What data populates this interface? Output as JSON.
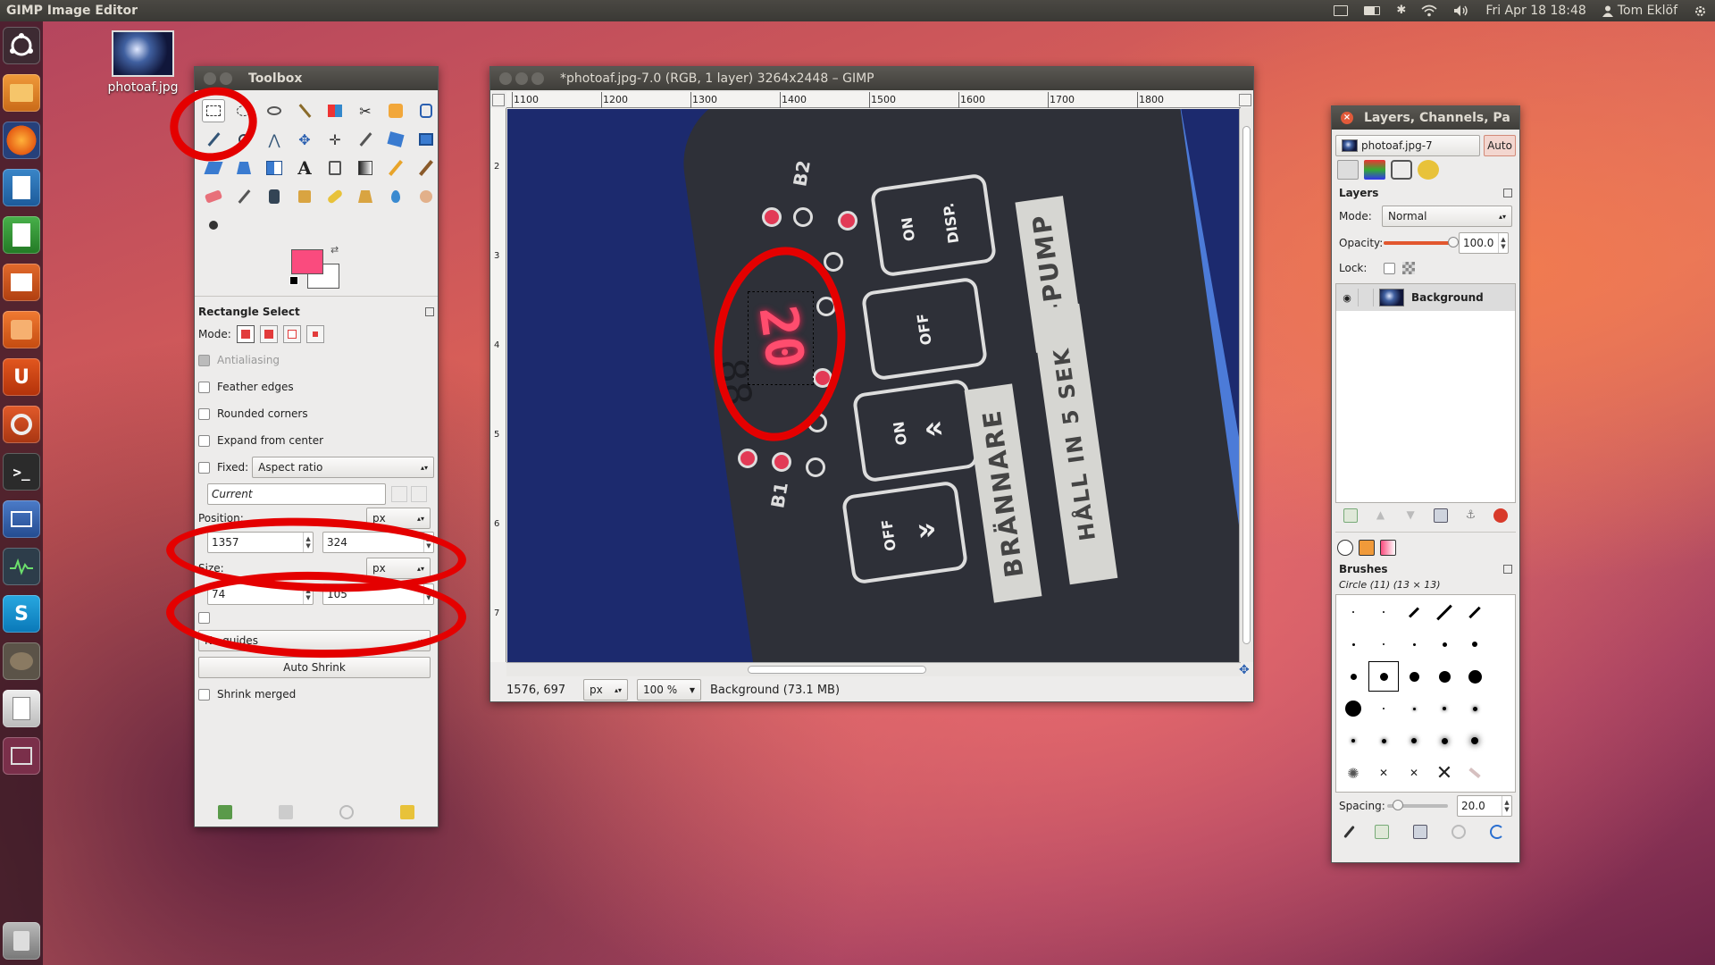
{
  "top_panel": {
    "app_title": "GIMP Image Editor",
    "datetime": "Fri Apr 18 18:48",
    "user": "Tom Eklöf"
  },
  "desktop": {
    "file_icon_label": "photoaf.jpg"
  },
  "toolbox": {
    "title": "Toolbox",
    "fg_color": "#fa4b7e",
    "bg_color": "#ffffff",
    "options": {
      "title": "Rectangle Select",
      "mode_label": "Mode:",
      "antialiasing": "Antialiasing",
      "feather_edges": "Feather edges",
      "rounded_corners": "Rounded corners",
      "expand_from_center": "Expand from center",
      "fixed_label": "Fixed:",
      "fixed_value": "Aspect ratio",
      "current": "Current",
      "position_label": "Position:",
      "position_unit": "px",
      "position_x": "1357",
      "position_y": "324",
      "size_label": "Size:",
      "size_unit": "px",
      "size_w": "74",
      "size_h": "105",
      "guides": "No guides",
      "auto_shrink": "Auto Shrink",
      "shrink_merged": "Shrink merged"
    }
  },
  "image_window": {
    "title": "*photoaf.jpg-7.0 (RGB, 1 layer) 3264x2448 – GIMP",
    "ruler_top": [
      "1100",
      "1200",
      "1300",
      "1400",
      "1500",
      "1600",
      "1700",
      "1800"
    ],
    "ruler_left": [
      "2",
      "3",
      "4",
      "5",
      "6",
      "7"
    ],
    "coords": "1576, 697",
    "unit": "px",
    "zoom": "100 %",
    "status": "Background (73.1 MB)",
    "photo": {
      "digit": "20",
      "label_on_1": "ON",
      "label_off_1": "OFF",
      "label_on_2": "ON",
      "label_off_2": "OFF",
      "label_disp": "DISP.",
      "sticker_cpump": "C-PUMP",
      "sticker_brannare": "BRÄNNARE",
      "sticker_hall": "HÅLL IN 5 SEK",
      "label_b1": "B1",
      "label_b2": "B2"
    }
  },
  "layers_window": {
    "title": "Layers, Channels, Pa",
    "image_select": "photoaf.jpg-7",
    "auto_button": "Auto",
    "layers_heading": "Layers",
    "mode_label": "Mode:",
    "mode_value": "Normal",
    "opacity_label": "Opacity:",
    "opacity_value": "100.0",
    "opacity_fraction": 1.0,
    "lock_label": "Lock:",
    "layer_name": "Background",
    "brushes_heading": "Brushes",
    "brush_name": "Circle (11) (13 × 13)",
    "spacing_label": "Spacing:",
    "spacing_value": "20.0"
  }
}
